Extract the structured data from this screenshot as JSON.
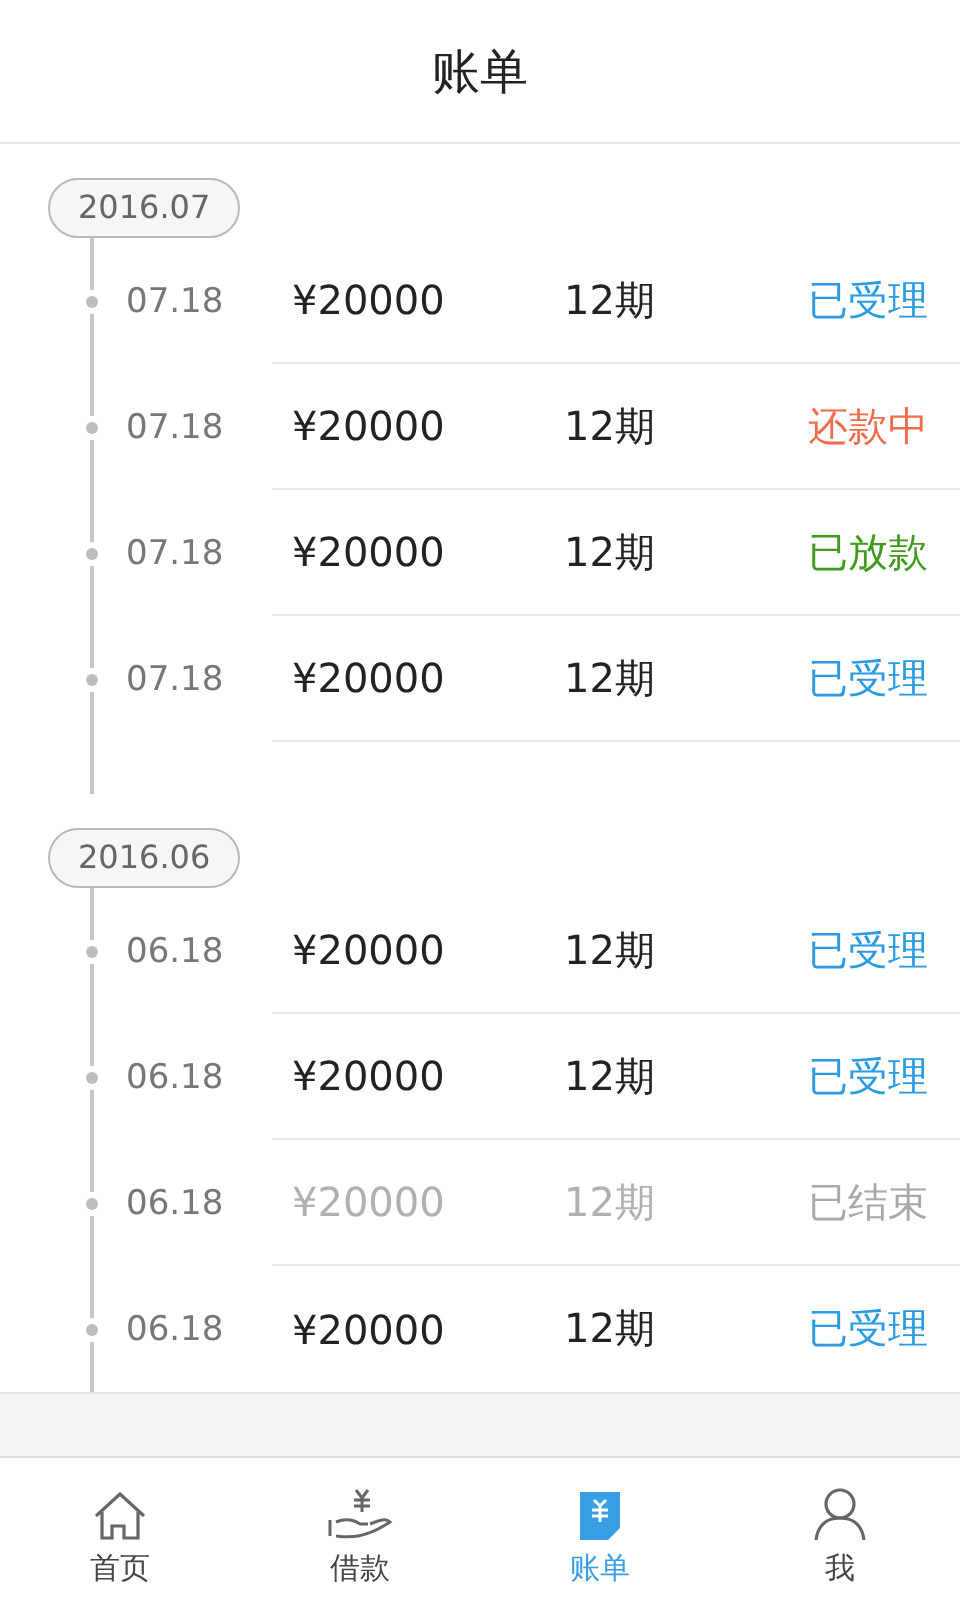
{
  "header": {
    "title": "账单"
  },
  "groups": [
    {
      "month": "2016.07",
      "records": [
        {
          "date": "07.18",
          "amount": "¥20000",
          "period": "12期",
          "status": "已受理",
          "kind": "accepted"
        },
        {
          "date": "07.18",
          "amount": "¥20000",
          "period": "12期",
          "status": "还款中",
          "kind": "repaying"
        },
        {
          "date": "07.18",
          "amount": "¥20000",
          "period": "12期",
          "status": "已放款",
          "kind": "disbursed"
        },
        {
          "date": "07.18",
          "amount": "¥20000",
          "period": "12期",
          "status": "已受理",
          "kind": "accepted"
        }
      ]
    },
    {
      "month": "2016.06",
      "records": [
        {
          "date": "06.18",
          "amount": "¥20000",
          "period": "12期",
          "status": "已受理",
          "kind": "accepted"
        },
        {
          "date": "06.18",
          "amount": "¥20000",
          "period": "12期",
          "status": "已受理",
          "kind": "accepted"
        },
        {
          "date": "06.18",
          "amount": "¥20000",
          "period": "12期",
          "status": "已结束",
          "kind": "closed"
        },
        {
          "date": "06.18",
          "amount": "¥20000",
          "period": "12期",
          "status": "已受理",
          "kind": "accepted"
        }
      ]
    }
  ],
  "tabs": [
    {
      "label": "首页",
      "selected": false
    },
    {
      "label": "借款",
      "selected": false
    },
    {
      "label": "账单",
      "selected": true
    },
    {
      "label": "我",
      "selected": false
    }
  ]
}
